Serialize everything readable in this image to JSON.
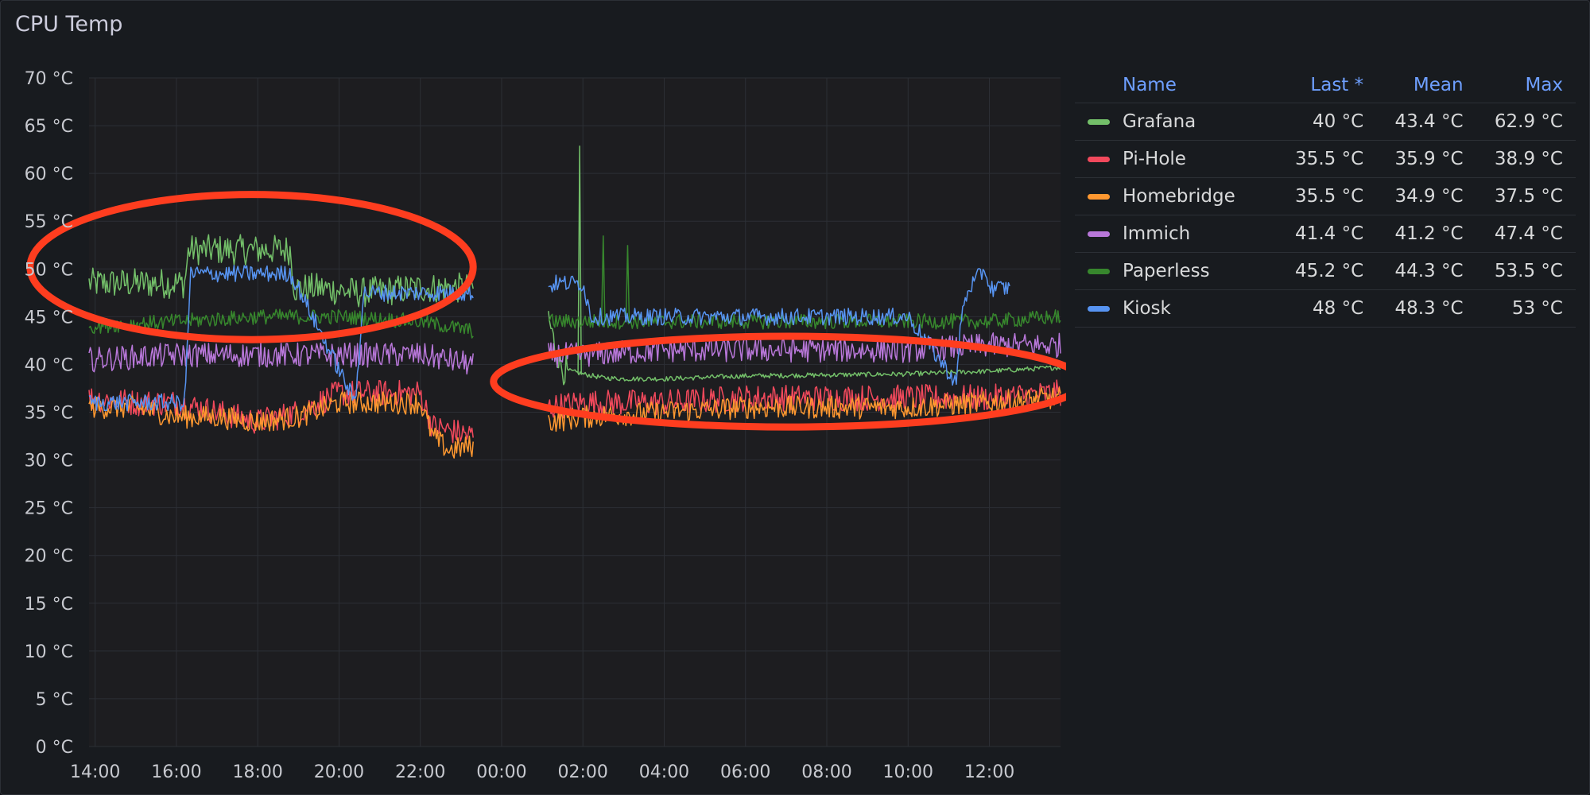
{
  "panel": {
    "title": "CPU Temp"
  },
  "legend": {
    "headers": {
      "name": "Name",
      "last": "Last *",
      "mean": "Mean",
      "max": "Max"
    },
    "rows": [
      {
        "name": "Grafana",
        "last": "40 °C",
        "mean": "43.4 °C",
        "max": "62.9 °C",
        "color": "#73bf69"
      },
      {
        "name": "Pi-Hole",
        "last": "35.5 °C",
        "mean": "35.9 °C",
        "max": "38.9 °C",
        "color": "#f2495c"
      },
      {
        "name": "Homebridge",
        "last": "35.5 °C",
        "mean": "34.9 °C",
        "max": "37.5 °C",
        "color": "#ff9830"
      },
      {
        "name": "Immich",
        "last": "41.4 °C",
        "mean": "41.2 °C",
        "max": "47.4 °C",
        "color": "#b877d9"
      },
      {
        "name": "Paperless",
        "last": "45.2 °C",
        "mean": "44.3 °C",
        "max": "53.5 °C",
        "color": "#37872d"
      },
      {
        "name": "Kiosk",
        "last": "48 °C",
        "mean": "48.3 °C",
        "max": "53 °C",
        "color": "#5794f2"
      }
    ]
  },
  "chart_data": {
    "type": "line",
    "title": "CPU Temp",
    "unit": "°C",
    "ylim": [
      0,
      70
    ],
    "y_ticks": [
      0,
      5,
      10,
      15,
      20,
      25,
      30,
      35,
      40,
      45,
      50,
      55,
      60,
      65,
      70
    ],
    "y_tick_labels": [
      "0 °C",
      "5 °C",
      "10 °C",
      "15 °C",
      "20 °C",
      "25 °C",
      "30 °C",
      "35 °C",
      "40 °C",
      "45 °C",
      "50 °C",
      "55 °C",
      "60 °C",
      "65 °C",
      "70 °C"
    ],
    "xlim": [
      13.85,
      37.75
    ],
    "x_ticks": [
      14,
      16,
      18,
      20,
      22,
      24,
      26,
      28,
      30,
      32,
      34,
      36
    ],
    "x_tick_labels": [
      "14:00",
      "16:00",
      "18:00",
      "20:00",
      "22:00",
      "00:00",
      "02:00",
      "04:00",
      "06:00",
      "08:00",
      "10:00",
      "12:00"
    ],
    "grid": true,
    "series": [
      {
        "name": "Grafana",
        "color": "#73bf69",
        "segments": [
          {
            "x": [
              13.85,
              16.2,
              16.3,
              18.8,
              18.9,
              19.5,
              20.5,
              22.0,
              23.3
            ],
            "y": [
              48.5,
              48.5,
              52,
              52,
              48,
              48,
              47.5,
              48,
              48
            ]
          },
          {
            "x": [
              25.15,
              25.3,
              25.5,
              26.0,
              26.5,
              27.0,
              28.0,
              30.0,
              32.0,
              34.0,
              36.0,
              37.75
            ],
            "y": [
              45,
              42,
              39.5,
              39,
              38.6,
              38.5,
              38.5,
              38.8,
              38.9,
              39,
              39.3,
              39.7
            ]
          }
        ],
        "spikes": [
          {
            "x": 25.92,
            "y": 62.9
          }
        ]
      },
      {
        "name": "Pi-Hole",
        "color": "#f2495c",
        "segments": [
          {
            "x": [
              13.85,
              15.0,
              16.0,
              17.0,
              18.0,
              19.0,
              20.0,
              21.0,
              22.0,
              22.3,
              23.3
            ],
            "y": [
              36.5,
              36,
              36,
              35,
              34,
              35,
              37,
              37,
              37,
              33.5,
              32.5
            ]
          },
          {
            "x": [
              25.15,
              26.0,
              28.0,
              30.0,
              32.0,
              34.0,
              36.0,
              37.75
            ],
            "y": [
              35.5,
              36,
              36,
              36.5,
              36.5,
              36.5,
              36.5,
              37
            ]
          }
        ]
      },
      {
        "name": "Homebridge",
        "color": "#ff9830",
        "segments": [
          {
            "x": [
              13.85,
              15.0,
              16.0,
              17.0,
              18.0,
              19.0,
              20.0,
              21.0,
              22.0,
              22.3,
              22.7,
              23.3
            ],
            "y": [
              35.5,
              35.5,
              34.5,
              34.5,
              34,
              34.5,
              36,
              36,
              36,
              32.5,
              31,
              31.5
            ]
          },
          {
            "x": [
              25.15,
              26.0,
              28.0,
              30.0,
              32.0,
              34.0,
              36.0,
              37.75
            ],
            "y": [
              34,
              34.5,
              35,
              35.5,
              35.5,
              35.5,
              36,
              36.5
            ]
          }
        ]
      },
      {
        "name": "Immich",
        "color": "#b877d9",
        "segments": [
          {
            "x": [
              13.85,
              16.0,
              18.0,
              20.0,
              22.0,
              23.3
            ],
            "y": [
              40.5,
              41,
              41,
              41,
              41,
              40
            ]
          },
          {
            "x": [
              25.15,
              26.0,
              28.0,
              30.0,
              32.0,
              34.0,
              36.0,
              37.75
            ],
            "y": [
              41,
              41,
              41.5,
              41.5,
              41.5,
              41.5,
              42,
              42
            ]
          }
        ]
      },
      {
        "name": "Paperless",
        "color": "#37872d",
        "segments": [
          {
            "x": [
              13.85,
              16.0,
              18.0,
              20.0,
              22.0,
              23.3
            ],
            "y": [
              44,
              44.5,
              45,
              45,
              44.5,
              43.5
            ]
          },
          {
            "x": [
              25.15,
              26.0,
              28.0,
              30.0,
              32.0,
              34.0,
              36.0,
              37.75
            ],
            "y": [
              44.5,
              44.5,
              44.5,
              44.5,
              44.5,
              44.5,
              44.5,
              45
            ]
          }
        ],
        "spikes": [
          {
            "x": 26.5,
            "y": 53.5
          },
          {
            "x": 27.1,
            "y": 52.5
          }
        ]
      },
      {
        "name": "Kiosk",
        "color": "#5794f2",
        "segments": [
          {
            "x": [
              13.85,
              16.2,
              16.35,
              18.8,
              19.0,
              20.4,
              20.6,
              22.0,
              23.3
            ],
            "y": [
              36,
              36,
              49.5,
              49.5,
              48,
              36,
              47.5,
              47.5,
              47.5
            ]
          },
          {
            "x": [
              25.15,
              25.3,
              26.0,
              26.2,
              28.0,
              30.0,
              32.0,
              34.0,
              35.2,
              35.3,
              35.5,
              35.9,
              36.0,
              36.5
            ],
            "y": [
              48,
              48.5,
              48.5,
              45,
              45,
              45,
              45,
              45,
              38,
              45,
              48,
              50,
              48,
              48
            ]
          }
        ]
      }
    ],
    "annotations": [
      {
        "shape": "ellipse",
        "color": "#ff3d1f",
        "cx": 17.85,
        "cy": 50.2,
        "rx": 5.45,
        "ry": 7.6
      },
      {
        "shape": "ellipse",
        "color": "#ff3d1f",
        "cx": 31.05,
        "cy": 38.2,
        "rx": 7.25,
        "ry": 4.75
      }
    ]
  }
}
